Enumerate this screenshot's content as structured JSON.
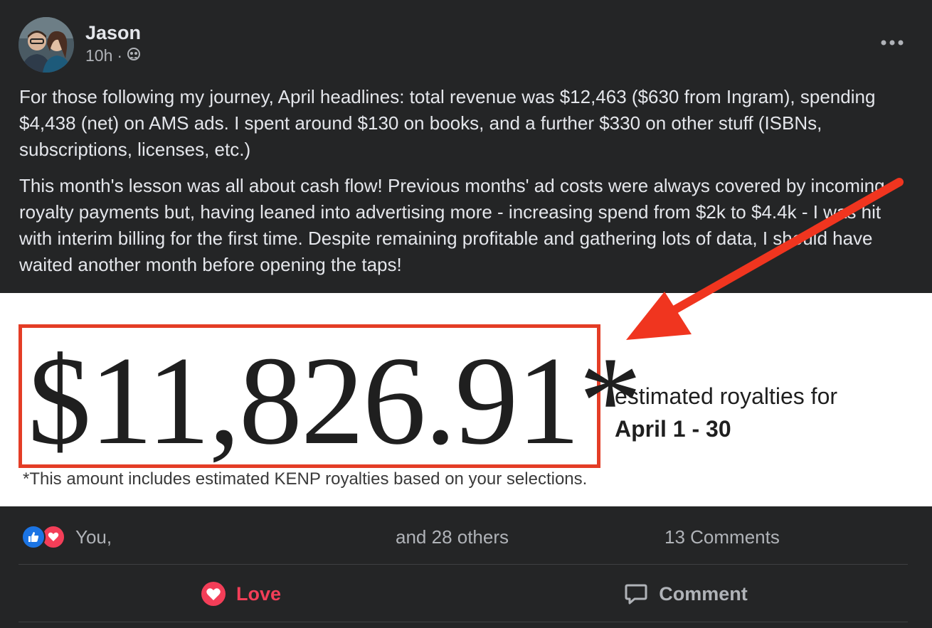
{
  "post": {
    "author": "Jason",
    "time": "10h",
    "separator": "·",
    "audience_icon": "friends-icon",
    "more_icon": "more-options-icon",
    "paragraphs": [
      "For those following my journey, April headlines: total revenue was $12,463 ($630 from Ingram), spending $4,438 (net) on AMS ads. I spent around $130 on books, and a further $330 on other stuff (ISBNs, subscriptions, licenses, etc.)",
      "This month's lesson was all about cash flow! Previous months' ad costs were always covered by incoming royalty payments but, having leaned into advertising more - increasing spend from $2k to $4.4k - I was hit with interim billing for the first time. Despite remaining profitable and gathering lots of data, I should have waited another month before opening the taps!"
    ]
  },
  "image": {
    "amount": "$11,826.91*",
    "caption_line1": "estimated royalties for",
    "caption_line2": "April 1 - 30",
    "footnote": "*This amount includes estimated KENP royalties based on your selections.",
    "highlight_color": "#e43d26",
    "arrow_color": "#f0351f"
  },
  "reactions": {
    "icons": [
      "like-icon",
      "love-icon"
    ],
    "reactors": "You,",
    "others": "and 28 others",
    "comments": "13 Comments"
  },
  "actions": {
    "love_label": "Love",
    "comment_label": "Comment"
  },
  "colors": {
    "background": "#242526",
    "text": "#e4e6eb",
    "secondary": "#b0b3b8",
    "love": "#f33e58",
    "like": "#1b74e4"
  }
}
